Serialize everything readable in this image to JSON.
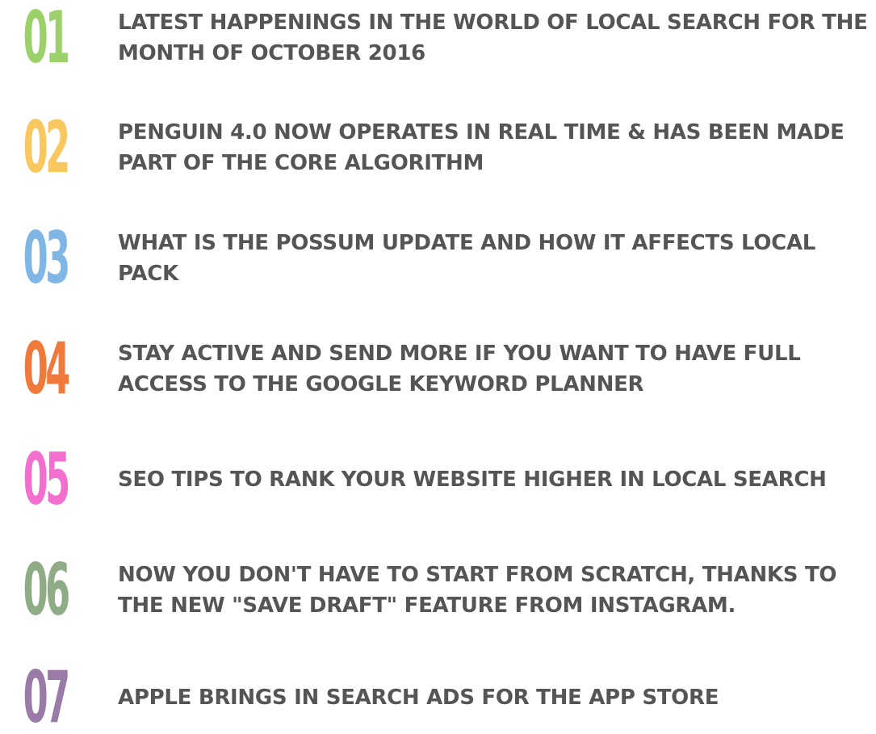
{
  "items": [
    {
      "number": "01",
      "color": "#9bd06a",
      "title": "LATEST HAPPENINGS IN THE WORLD OF LOCAL SEARCH FOR THE MONTH OF OCTOBER 2016"
    },
    {
      "number": "02",
      "color": "#f9c75f",
      "title": "PENGUIN 4.0 NOW OPERATES IN REAL TIME & HAS BEEN MADE PART OF THE CORE ALGORITHM"
    },
    {
      "number": "03",
      "color": "#7fb6e6",
      "title": "WHAT IS THE POSSUM UPDATE AND HOW IT AFFECTS LOCAL PACK"
    },
    {
      "number": "04",
      "color": "#f07a3c",
      "title": "STAY ACTIVE AND SEND MORE IF YOU WANT TO HAVE FULL ACCESS TO THE GOOGLE KEYWORD PLANNER"
    },
    {
      "number": "05",
      "color": "#f26fcf",
      "title": "SEO TIPS TO RANK YOUR WEBSITE HIGHER IN LOCAL SEARCH"
    },
    {
      "number": "06",
      "color": "#8fac86",
      "title": "NOW YOU DON'T HAVE TO START FROM SCRATCH, THANKS TO THE NEW \"SAVE DRAFT\" FEATURE FROM INSTAGRAM."
    },
    {
      "number": "07",
      "color": "#9a7aa6",
      "title": "APPLE BRINGS IN SEARCH ADS FOR THE APP STORE"
    }
  ]
}
